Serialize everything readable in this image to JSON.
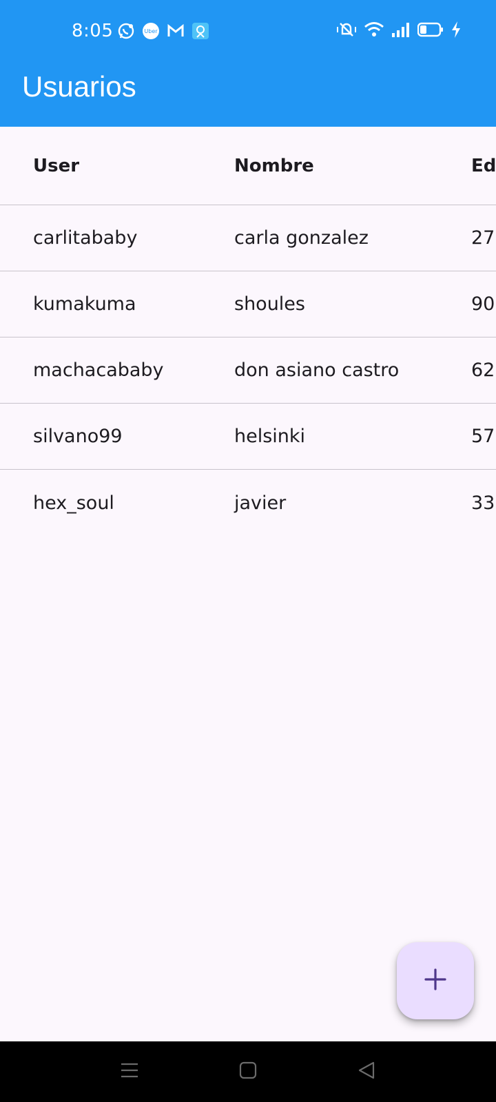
{
  "status_bar": {
    "time": "8:05",
    "notification_icons": [
      "whatsapp-icon",
      "uber-icon",
      "gmail-icon",
      "app-icon"
    ],
    "system_icons": [
      "vibrate-silent-icon",
      "wifi-icon",
      "signal-icon",
      "battery-icon",
      "charging-icon"
    ],
    "color": "#2196f3"
  },
  "app_bar": {
    "title": "Usuarios",
    "color": "#2196f3"
  },
  "table": {
    "columns": [
      "User",
      "Nombre",
      "Eda"
    ],
    "rows": [
      {
        "user": "carlitababy",
        "nombre": "carla gonzalez",
        "edad": "27"
      },
      {
        "user": "kumakuma",
        "nombre": "shoules",
        "edad": "90"
      },
      {
        "user": "machacababy",
        "nombre": "don asiano castro",
        "edad": "62"
      },
      {
        "user": "silvano99",
        "nombre": "helsinki",
        "edad": "57"
      },
      {
        "user": "hex_soul",
        "nombre": "javier",
        "edad": "33"
      }
    ]
  },
  "fab": {
    "icon": "plus-icon",
    "color": "#eaddff",
    "icon_color": "#4f378b"
  },
  "nav_bar": {
    "buttons": [
      "menu-icon",
      "home-icon",
      "back-icon"
    ]
  }
}
